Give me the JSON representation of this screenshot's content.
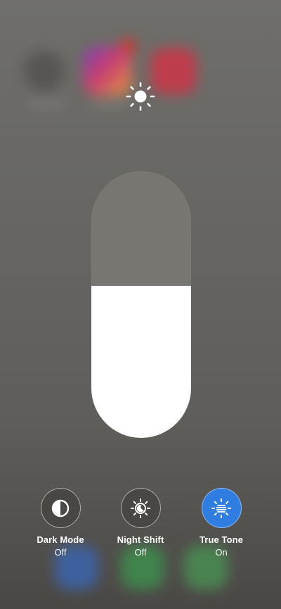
{
  "brightness": {
    "icon": "sun-icon",
    "level": 0.57
  },
  "controls": [
    {
      "label": "Dark Mode",
      "state": "Off",
      "icon": "dark-mode-icon",
      "active": false
    },
    {
      "label": "Night Shift",
      "state": "Off",
      "icon": "night-shift-icon",
      "active": false
    },
    {
      "label": "True Tone",
      "state": "On",
      "icon": "true-tone-icon",
      "active": true
    }
  ],
  "colors": {
    "accent": "#2f7de1",
    "slider_fill": "#ffffff",
    "slider_track": "#787772"
  }
}
